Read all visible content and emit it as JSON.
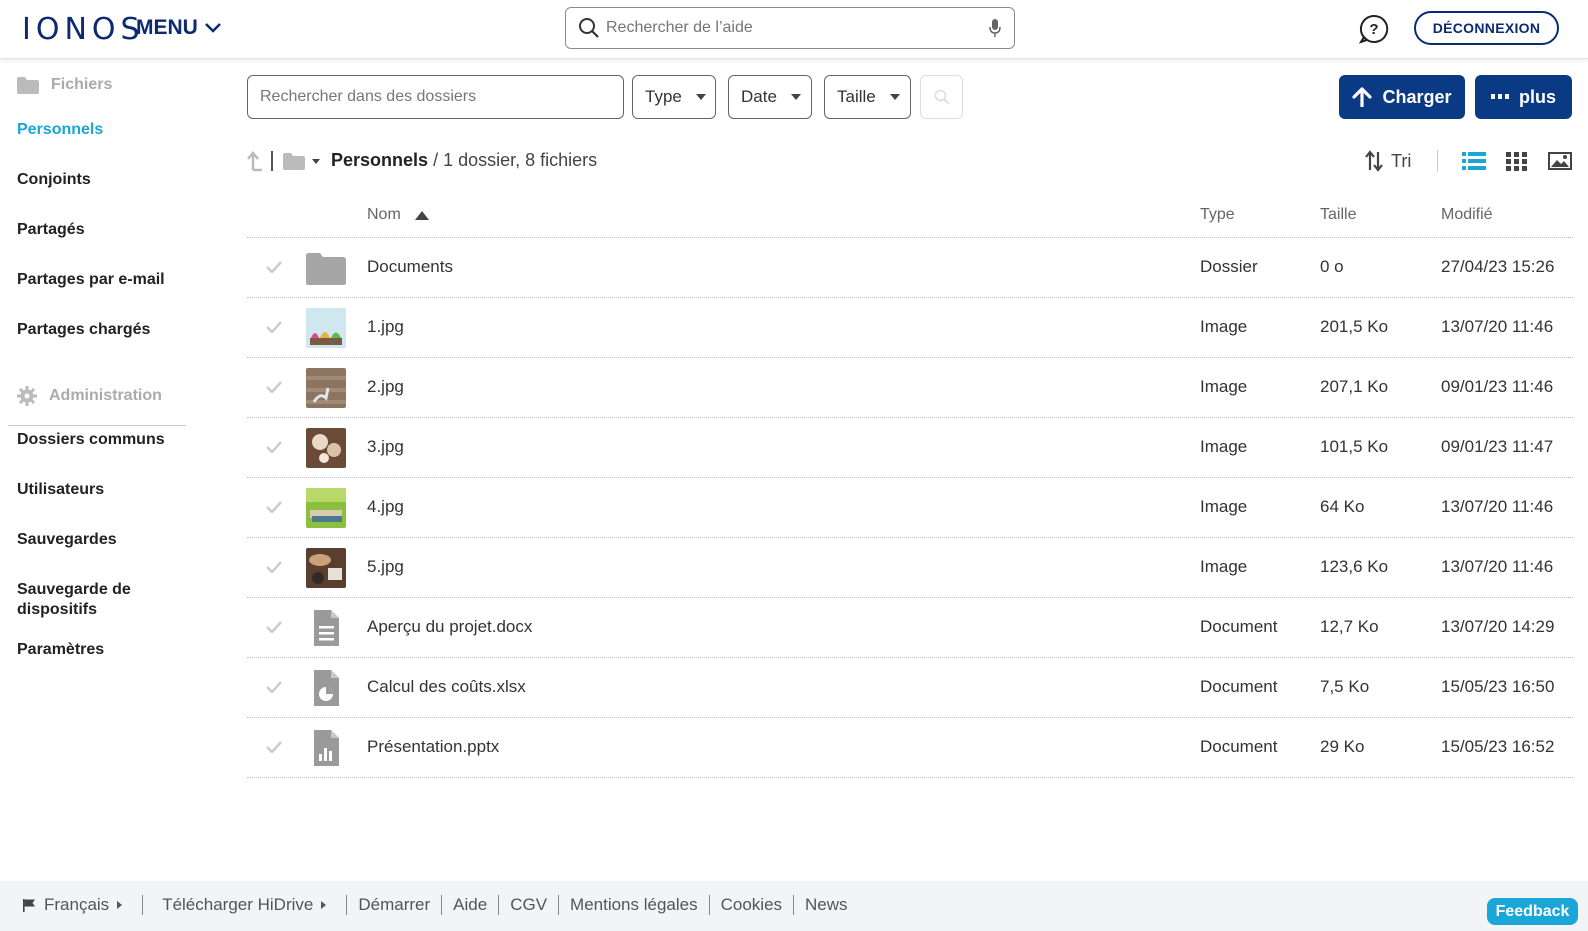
{
  "header": {
    "logo": "IONOS",
    "menu_label": "MENU",
    "help_search_placeholder": "Rechercher de l’aide",
    "logout_label": "DÉCONNEXION"
  },
  "sidebar": {
    "files_section": "Fichiers",
    "items": [
      "Personnels",
      "Conjoints",
      "Partagés",
      "Partages par e-mail",
      "Partages chargés"
    ],
    "admin_section": "Administration",
    "admin_items": [
      "Dossiers communs",
      "Utilisateurs",
      "Sauvegardes",
      "Sauvegarde de dispositifs",
      "Paramètres"
    ],
    "active_item": "Personnels"
  },
  "toolbar": {
    "folder_search_placeholder": "Rechercher dans des dossiers",
    "filters": [
      "Type",
      "Date",
      "Taille"
    ],
    "upload_label": "Charger",
    "more_label": "plus"
  },
  "breadcrumb": {
    "folder": "Personnels",
    "summary": "/ 1 dossier, 8 fichiers"
  },
  "view": {
    "sort_label": "Tri"
  },
  "table": {
    "columns": [
      "Nom",
      "Type",
      "Taille",
      "Modifié"
    ],
    "rows": [
      {
        "name": "Documents",
        "type": "Dossier",
        "size": "0 o",
        "modified": "27/04/23 15:26",
        "icon": "folder-icon"
      },
      {
        "name": "1.jpg",
        "type": "Image",
        "size": "201,5 Ko",
        "modified": "13/07/20 11:46",
        "icon": "image-thumbnail"
      },
      {
        "name": "2.jpg",
        "type": "Image",
        "size": "207,1 Ko",
        "modified": "09/01/23 11:46",
        "icon": "image-thumbnail"
      },
      {
        "name": "3.jpg",
        "type": "Image",
        "size": "101,5 Ko",
        "modified": "09/01/23 11:47",
        "icon": "image-thumbnail"
      },
      {
        "name": "4.jpg",
        "type": "Image",
        "size": "64 Ko",
        "modified": "13/07/20 11:46",
        "icon": "image-thumbnail"
      },
      {
        "name": "5.jpg",
        "type": "Image",
        "size": "123,6 Ko",
        "modified": "13/07/20 11:46",
        "icon": "image-thumbnail"
      },
      {
        "name": "Aperçu du projet.docx",
        "type": "Document",
        "size": "12,7 Ko",
        "modified": "13/07/20 14:29",
        "icon": "text-document-icon"
      },
      {
        "name": "Calcul des coûts.xlsx",
        "type": "Document",
        "size": "7,5 Ko",
        "modified": "15/05/23 16:50",
        "icon": "spreadsheet-document-icon"
      },
      {
        "name": "Présentation.pptx",
        "type": "Document",
        "size": "29 Ko",
        "modified": "15/05/23 16:52",
        "icon": "presentation-document-icon"
      }
    ]
  },
  "footer": {
    "language": "Français",
    "links": [
      "Télécharger HiDrive",
      "Démarrer",
      "Aide",
      "CGV",
      "Mentions légales",
      "Cookies",
      "News"
    ],
    "feedback_label": "Feedback"
  },
  "colors": {
    "brand_navy": "#0b2a6f",
    "button_blue": "#0b3a84",
    "accent_cyan": "#1aa6d6"
  }
}
